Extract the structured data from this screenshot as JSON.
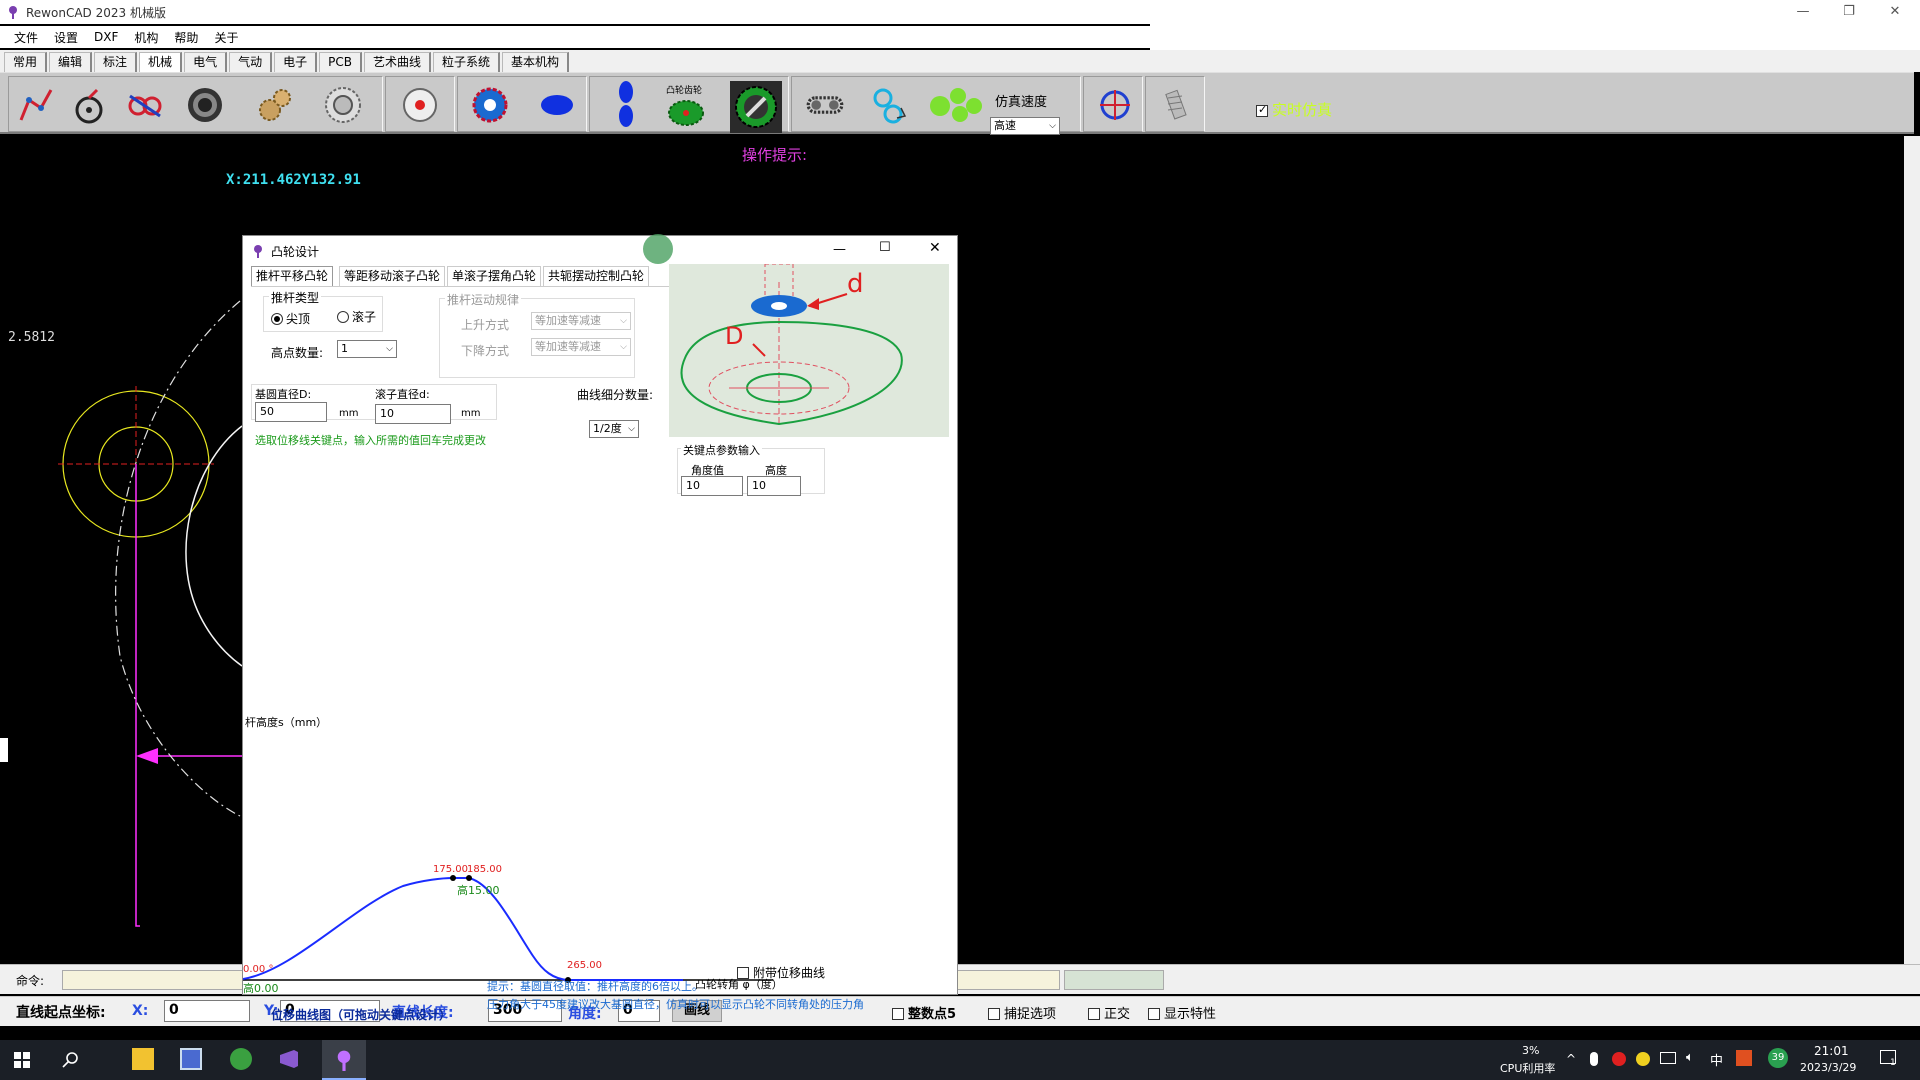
{
  "window": {
    "title": "RewonCAD 2023 机械版",
    "minimize": "—",
    "restore": "❐",
    "close": "✕"
  },
  "menu": [
    "文件",
    "设置",
    "DXF",
    "机构",
    "帮助",
    "关于"
  ],
  "ribbon_tabs": [
    "常用",
    "编辑",
    "标注",
    "机械",
    "电气",
    "气动",
    "电子",
    "PCB",
    "艺术曲线",
    "粒子系统",
    "基本机构"
  ],
  "toolbar": {
    "cam_label": "凸轮齿轮",
    "speed_label": "仿真速度",
    "speed_value": "高速",
    "realtime_label": "实时仿真",
    "realtime_checked": true
  },
  "canvas": {
    "hint": "操作提示:",
    "coords": "X:211.462Y132.91",
    "dim_value": "2.5812"
  },
  "dialog": {
    "title": "凸轮设计",
    "tabs": [
      "推杆平移凸轮",
      "等距移动滚子凸轮",
      "单滚子摆角凸轮",
      "共轭摆动控制凸轮"
    ],
    "pusher_type_label": "推杆类型",
    "radio_tip": "尖顶",
    "radio_roller": "滚子",
    "peak_count_label": "高点数量:",
    "peak_count_value": "1",
    "motion_label": "推杆运动规律",
    "rise_label": "上升方式",
    "rise_value": "等加速等减速",
    "fall_label": "下降方式",
    "fall_value": "等加速等减速",
    "base_dia_label": "基圆直径D:",
    "base_dia_value": "50",
    "roller_dia_label": "滚子直径d:",
    "roller_dia_value": "10",
    "unit": "mm",
    "subdiv_label": "曲线细分数量:",
    "subdiv_value": "1/2度",
    "select_hint": "选取位移线关键点，输入所需的值回车完成更改",
    "key_params_label": "关键点参数输入",
    "angle_label": "角度值",
    "height_label": "高度",
    "angle_value": "10",
    "height_value": "10",
    "y_axis_label": "杆高度s（mm）",
    "x_axis_label": "凸轮转角 φ（度）",
    "attach_curve_label": "附带位移曲线",
    "curve_caption": "位移曲线图（可拖动关键点设计）",
    "tip1": "提示：基圆直径取值：推杆高度的6倍以上。",
    "tip2": "压力角大于45度建议改大基圆直径，仿真时可以显示凸轮不同转角处的压力角",
    "pt_start_angle": "0.00 °",
    "pt_start_height": "高0.00",
    "pt_a_angle": "175.00",
    "pt_b_angle": "185.00",
    "pt_top_height": "高15.00",
    "pt_end_angle": "265.00",
    "figure_d_small": "d",
    "figure_d_big": "D"
  },
  "cmdbar": {
    "label": "命令:"
  },
  "statusbar": {
    "start_label": "直线起点坐标:",
    "x_label": "X:",
    "x_value": "0",
    "y_label": "Y:",
    "y_value": "0",
    "length_label": "直线长度:",
    "length_value": "300",
    "angle_label": "角度:",
    "angle_value": "0",
    "draw_button": "画线",
    "snap5_label": "整数点5",
    "capture_label": "捕捉选项",
    "ortho_label": "正交",
    "props_label": "显示特性"
  },
  "taskbar": {
    "cpu_percent": "3%",
    "cpu_label": "CPU利用率",
    "ime": "中",
    "time": "21:01",
    "date": "2023/3/29",
    "notif_count": "1",
    "badge": "39"
  },
  "colors": {
    "accent_magenta": "#ff00ff",
    "coord_cyan": "#3fe0f0",
    "curve_blue": "#1a2cff",
    "hint_green": "#1a9a1a"
  }
}
